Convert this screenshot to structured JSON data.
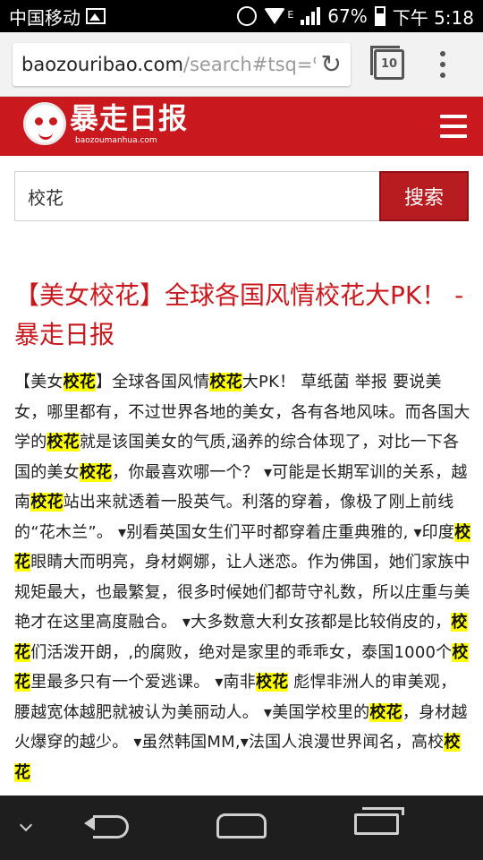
{
  "status_bar": {
    "carrier": "中国移动",
    "battery": "67%",
    "time": "下午 5:18",
    "network_type": "E",
    "icons": [
      "image-icon",
      "alarm-icon",
      "wifi-icon",
      "signal-icon",
      "battery-icon"
    ]
  },
  "browser": {
    "url_host": "baozouribao.com",
    "url_path": "/search#tsq=%",
    "tab_count": "10",
    "icons": [
      "reload-icon",
      "tabs-icon",
      "menu-dots-icon"
    ]
  },
  "site": {
    "logo_text": "暴走日报",
    "logo_subtext": "baozoumanhua.com",
    "brand_color": "#c9191e",
    "icons": [
      "logo-face-icon",
      "hamburger-menu-icon"
    ]
  },
  "search": {
    "query": "校花",
    "button_label": "搜索"
  },
  "result": {
    "title": "【美女校花】全球各国风情校花大PK！ - 暴走日报",
    "snippet_segments": [
      {
        "text": "【美女",
        "hl": false
      },
      {
        "text": "校花",
        "hl": true
      },
      {
        "text": "】全球各国风情",
        "hl": false
      },
      {
        "text": "校花",
        "hl": true
      },
      {
        "text": "大PK！ 草纸菌 举报 要说美女，哪里都有，不过世界各地的美女，各有各地风味。而各国大学的",
        "hl": false
      },
      {
        "text": "校花",
        "hl": true
      },
      {
        "text": "就是该国美女的气质,涵养的综合体现了，对比一下各国的美女",
        "hl": false
      },
      {
        "text": "校花",
        "hl": true
      },
      {
        "text": "，你最喜欢哪一个？ ▾可能是长期军训的关系，越南",
        "hl": false
      },
      {
        "text": "校花",
        "hl": true
      },
      {
        "text": "站出来就透着一股英气。利落的穿着，像极了刚上前线的“花木兰”。 ▾别看英国女生们平时都穿着庄重典雅的, ▾印度",
        "hl": false
      },
      {
        "text": "校花",
        "hl": true
      },
      {
        "text": "眼睛大而明亮，身材婀娜，让人迷恋。作为佛国，她们家族中规矩最大，也最繁复，很多时候她们都苛守礼数，所以庄重与美艳才在这里高度融合。 ▾大多数意大利女孩都是比较俏皮的，",
        "hl": false
      },
      {
        "text": "校花",
        "hl": true
      },
      {
        "text": "们活泼开朗，,的腐败，绝对是家里的乖乖女，泰国1000个",
        "hl": false
      },
      {
        "text": "校花",
        "hl": true
      },
      {
        "text": "里最多只有一个爱逃课。 ▾南非",
        "hl": false
      },
      {
        "text": "校花",
        "hl": true
      },
      {
        "text": "  彪悍非洲人的审美观，腰越宽体越肥就被认为美丽动人。 ▾美国学校里的",
        "hl": false
      },
      {
        "text": "校花",
        "hl": true
      },
      {
        "text": "，身材越火爆穿的越少。 ▾虽然韩国MM,▾法国人浪漫世界闻名，高校",
        "hl": false
      },
      {
        "text": "校花",
        "hl": true
      }
    ]
  },
  "nav_bar": {
    "icons": [
      "chevron-down-icon",
      "back-icon",
      "home-icon",
      "recent-apps-icon"
    ]
  }
}
